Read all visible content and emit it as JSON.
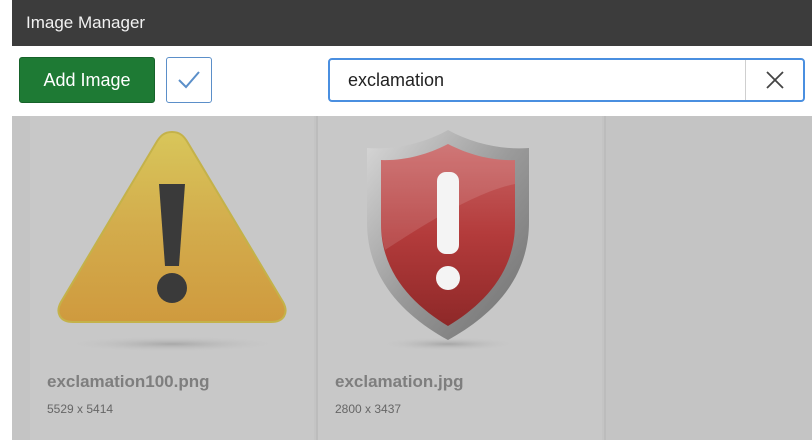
{
  "window": {
    "title": "Image Manager"
  },
  "toolbar": {
    "add_label": "Add Image",
    "search_value": "exclamation"
  },
  "icons": {
    "select": "checkmark-icon",
    "clear": "close-icon"
  },
  "images": [
    {
      "filename": "exclamation100.png",
      "dimensions": "5529 x 5414"
    },
    {
      "filename": "exclamation.jpg",
      "dimensions": "2800 x 3437"
    }
  ],
  "colors": {
    "titlebar": "#3c3c3c",
    "add_button": "#1e7a34",
    "search_border": "#4a8fe0",
    "grid_background": "#c4c4c4"
  }
}
